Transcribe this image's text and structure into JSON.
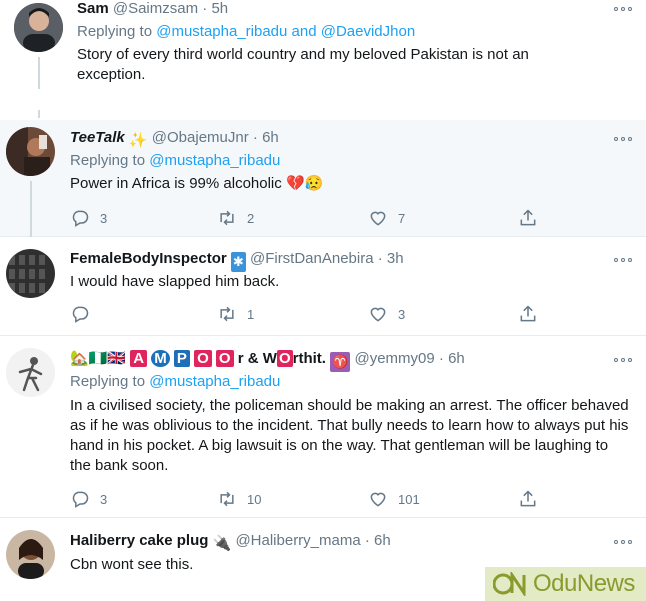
{
  "tweets": [
    {
      "name": "Sam",
      "handle": "@Saimzsam",
      "dot": "·",
      "time": "5h",
      "replying_label": "Replying to",
      "mention1": "@mustapha_ribadu",
      "and_label": "and",
      "mention2": "@DaevidJhon",
      "text": "Story of every third world country and my beloved Pakistan is not an exception."
    },
    {
      "name": "TeeTalk",
      "badge": "✨",
      "handle": "@ObajemuJnr",
      "dot": "·",
      "time": "6h",
      "replying_label": "Replying to",
      "mention1": "@mustapha_ribadu",
      "text": "Power in Africa is 99% alcoholic",
      "emoji": "💔😥",
      "replies": "3",
      "retweets": "2",
      "likes": "7"
    },
    {
      "name": "FemaleBodyInspector",
      "badge": "✱",
      "handle": "@FirstDanAnebira",
      "dot": "·",
      "time": "3h",
      "text": "I would have slapped him back.",
      "replies": "",
      "retweets": "1",
      "likes": "3"
    },
    {
      "name_prefix": "🏡🇳🇬🇬🇧",
      "name_letters": [
        "A",
        "M",
        "P",
        "O",
        "O"
      ],
      "name_mid": "r & W",
      "name_letter_o": "O",
      "name_suffix": "rthit.",
      "badge": "♈",
      "handle": "@yemmy09",
      "dot": "·",
      "time": "6h",
      "replying_label": "Replying to",
      "mention1": "@mustapha_ribadu",
      "text": "In a civilised society, the policeman should be making an arrest. The officer behaved as if he was oblivious to the incident. That bully needs to learn how to always put his hand in his pocket. A big lawsuit is on the way. That gentleman will be laughing to the bank soon.",
      "replies": "3",
      "retweets": "10",
      "likes": "101"
    },
    {
      "name": "Haliberry cake plug",
      "badge": "🔌",
      "handle": "@Haliberry_mama",
      "dot": "·",
      "time": "6h",
      "text": "Cbn wont see this."
    }
  ],
  "watermark": {
    "text": "OduNews"
  },
  "colors": {
    "link": "#1da1f2",
    "secondary": "#657786",
    "highlight_red": "#e0245e",
    "highlight_blue": "#1d6fb8",
    "watermark_bg": "#e2eac6",
    "watermark_fg": "#8a9a2c"
  }
}
